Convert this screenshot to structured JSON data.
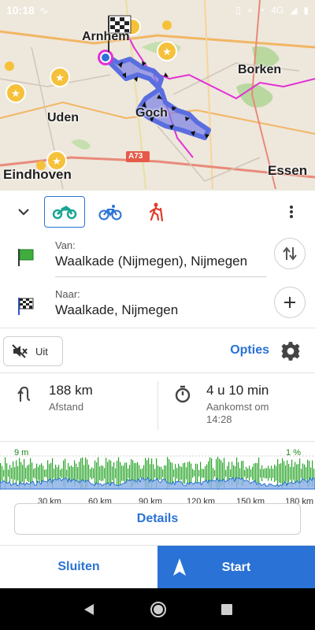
{
  "status_bar": {
    "time": "10:18",
    "network": "4G"
  },
  "map": {
    "cities": [
      {
        "name": "Arnhem"
      },
      {
        "name": "Borken"
      },
      {
        "name": "Uden"
      },
      {
        "name": "Goch"
      },
      {
        "name": "Eindhoven"
      },
      {
        "name": "Essen"
      }
    ],
    "road_label": "A73"
  },
  "transport_modes": [
    {
      "name": "motorcycle",
      "active": true
    },
    {
      "name": "bicycle",
      "active": false
    },
    {
      "name": "hiking",
      "active": false
    }
  ],
  "route": {
    "from_label": "Van:",
    "from_value": "Waalkade (Nijmegen), Nijmegen",
    "to_label": "Naar:",
    "to_value": "Waalkade, Nijmegen"
  },
  "options": {
    "mute_label": "Uit",
    "options_label": "Opties"
  },
  "stats": {
    "distance_value": "188 km",
    "distance_label": "Afstand",
    "duration_value": "4 u 10 min",
    "arrival_label": "Aankomst om",
    "arrival_time": "14:28"
  },
  "elevation_chart": {
    "top_left_label": "9 m",
    "top_right_label": "1 %",
    "x_ticks": [
      "30 km",
      "60 km",
      "90 km",
      "120 km",
      "150 km",
      "180 km"
    ]
  },
  "details_label": "Details",
  "bottom": {
    "close_label": "Sluiten",
    "start_label": "Start"
  },
  "colors": {
    "accent": "#2a72d6",
    "route": "#5a6ee0",
    "elevation_fill": "#8fb3e8",
    "slope": "#2aa52a"
  }
}
